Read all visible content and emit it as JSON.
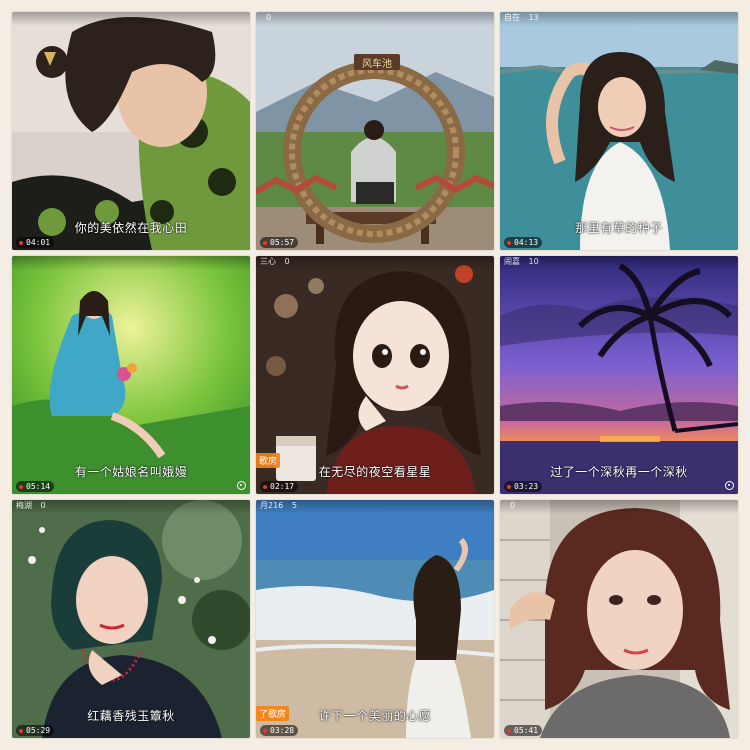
{
  "tiles": [
    {
      "top_left": "",
      "viewers": "",
      "caption": "你的美依然在我心田",
      "duration": "04:01"
    },
    {
      "top_left": "",
      "viewers": "0",
      "sign_text": "风车池",
      "caption": "",
      "duration": "05:57"
    },
    {
      "top_left": "自在",
      "viewers": "13",
      "caption": "那里有草的种子",
      "duration": "04:13"
    },
    {
      "top_left": "",
      "viewers": "",
      "caption": "有一个姑娘名叫娥嫚",
      "duration": "05:14"
    },
    {
      "top_left": "三心",
      "viewers": "0",
      "room_tag": "歌房",
      "caption": "在无尽的夜空看星星",
      "duration": "02:17"
    },
    {
      "top_left": "闹嘉",
      "viewers": "10",
      "caption": "过了一个深秋再一个深秋",
      "duration": "03:23"
    },
    {
      "top_left": "梅湖",
      "viewers": "0",
      "caption": "红藕香残玉簟秋",
      "duration": "05:29"
    },
    {
      "top_left": "月216",
      "viewers": "5",
      "room_tag": "了歌房",
      "caption": "许下一个美丽的心愿",
      "duration": "03:28"
    },
    {
      "top_left": "",
      "viewers": "0",
      "caption": "",
      "duration": "05:41"
    }
  ],
  "colors": {
    "room_tag": "#f5820e",
    "recording_dot": "#e33333"
  }
}
